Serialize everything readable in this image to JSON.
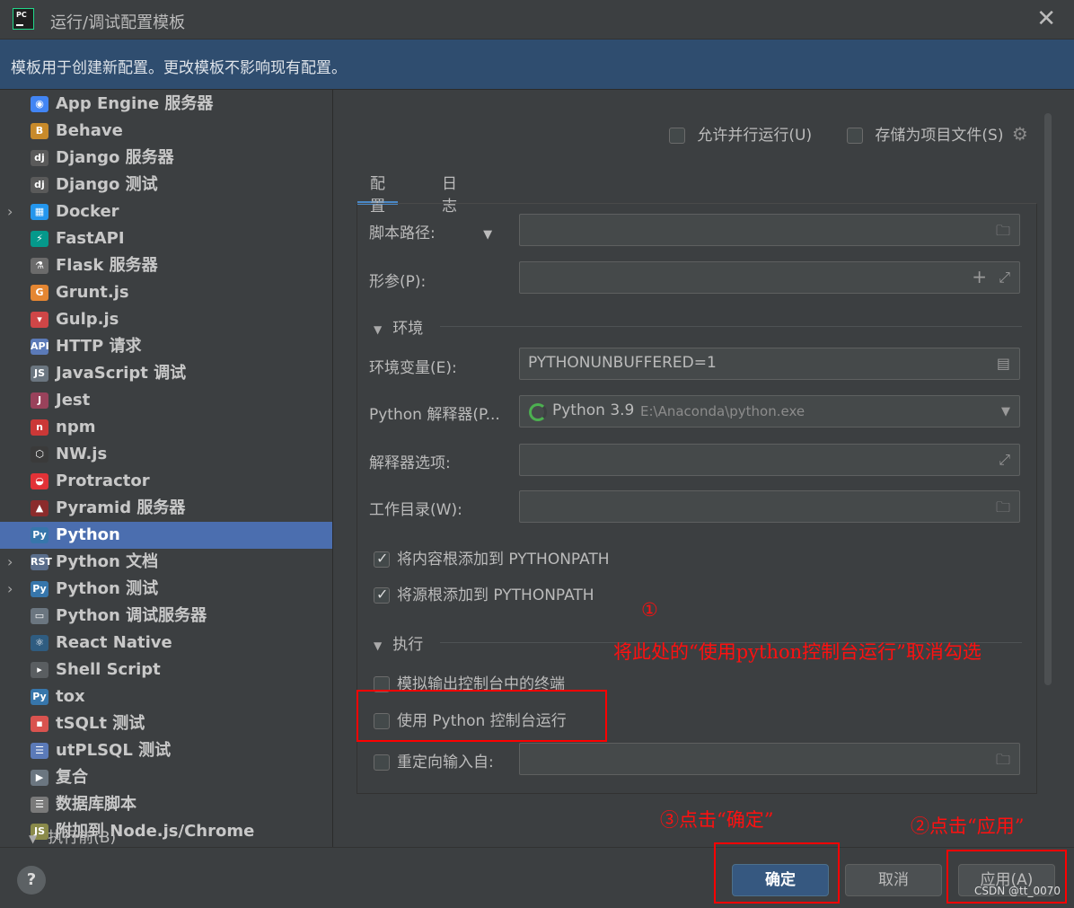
{
  "window": {
    "title": "运行/调试配置模板",
    "app_icon_text": "PC"
  },
  "banner": {
    "text": "模板用于创建新配置。更改模板不影响现有配置。"
  },
  "sidebar": {
    "items": [
      {
        "label": "App Engine 服务器",
        "icon": "app-engine-icon",
        "color": "#4285f4",
        "glyph": "◉",
        "expandable": false,
        "selected": false
      },
      {
        "label": "Behave",
        "icon": "behave-icon",
        "color": "#c88a2a",
        "glyph": "B",
        "expandable": false,
        "selected": false
      },
      {
        "label": "Django 服务器",
        "icon": "django-icon",
        "color": "#5a5a5a",
        "glyph": "dj",
        "expandable": false,
        "selected": false
      },
      {
        "label": "Django 测试",
        "icon": "django-test-icon",
        "color": "#5a5a5a",
        "glyph": "dj",
        "expandable": false,
        "selected": false
      },
      {
        "label": "Docker",
        "icon": "docker-icon",
        "color": "#2496ed",
        "glyph": "▦",
        "expandable": true,
        "selected": false
      },
      {
        "label": "FastAPI",
        "icon": "fastapi-icon",
        "color": "#05998b",
        "glyph": "⚡",
        "expandable": false,
        "selected": false
      },
      {
        "label": "Flask 服务器",
        "icon": "flask-icon",
        "color": "#6b6b6b",
        "glyph": "⚗",
        "expandable": false,
        "selected": false
      },
      {
        "label": "Grunt.js",
        "icon": "grunt-icon",
        "color": "#e48632",
        "glyph": "G",
        "expandable": false,
        "selected": false
      },
      {
        "label": "Gulp.js",
        "icon": "gulp-icon",
        "color": "#cf4647",
        "glyph": "▾",
        "expandable": false,
        "selected": false
      },
      {
        "label": "HTTP 请求",
        "icon": "http-api-icon",
        "color": "#5b7ab8",
        "glyph": "API",
        "expandable": false,
        "selected": false
      },
      {
        "label": "JavaScript 调试",
        "icon": "javascript-debug-icon",
        "color": "#6b7680",
        "glyph": "JS",
        "expandable": false,
        "selected": false
      },
      {
        "label": "Jest",
        "icon": "jest-icon",
        "color": "#99425b",
        "glyph": "J",
        "expandable": false,
        "selected": false
      },
      {
        "label": "npm",
        "icon": "npm-icon",
        "color": "#cb3837",
        "glyph": "n",
        "expandable": false,
        "selected": false
      },
      {
        "label": "NW.js",
        "icon": "nwjs-icon",
        "color": "#3a3a3a",
        "glyph": "⬡",
        "expandable": false,
        "selected": false
      },
      {
        "label": "Protractor",
        "icon": "protractor-icon",
        "color": "#e23237",
        "glyph": "◒",
        "expandable": false,
        "selected": false
      },
      {
        "label": "Pyramid 服务器",
        "icon": "pyramid-icon",
        "color": "#8b2c2c",
        "glyph": "▲",
        "expandable": false,
        "selected": false
      },
      {
        "label": "Python",
        "icon": "python-icon",
        "color": "#3776ab",
        "glyph": "Py",
        "expandable": false,
        "selected": true
      },
      {
        "label": "Python 文档",
        "icon": "python-docs-icon",
        "color": "#5a6e8c",
        "glyph": "RST",
        "expandable": true,
        "selected": false
      },
      {
        "label": "Python 测试",
        "icon": "python-tests-icon",
        "color": "#3776ab",
        "glyph": "Py",
        "expandable": true,
        "selected": false
      },
      {
        "label": "Python 调试服务器",
        "icon": "python-debug-server-icon",
        "color": "#6b7680",
        "glyph": "▭",
        "expandable": false,
        "selected": false
      },
      {
        "label": "React Native",
        "icon": "react-native-icon",
        "color": "#2f5c80",
        "glyph": "⚛",
        "expandable": false,
        "selected": false
      },
      {
        "label": "Shell Script",
        "icon": "shell-script-icon",
        "color": "#5a5e61",
        "glyph": "▸",
        "expandable": false,
        "selected": false
      },
      {
        "label": "tox",
        "icon": "tox-icon",
        "color": "#3776ab",
        "glyph": "Py",
        "expandable": false,
        "selected": false
      },
      {
        "label": "tSQLt 测试",
        "icon": "tsqlt-icon",
        "color": "#d9534f",
        "glyph": "▪",
        "expandable": false,
        "selected": false
      },
      {
        "label": "utPLSQL 测试",
        "icon": "utplsql-icon",
        "color": "#5b7ab8",
        "glyph": "☰",
        "expandable": false,
        "selected": false
      },
      {
        "label": "复合",
        "icon": "compound-icon",
        "color": "#6b7680",
        "glyph": "▶",
        "expandable": false,
        "selected": false
      },
      {
        "label": "数据库脚本",
        "icon": "database-script-icon",
        "color": "#7a7a7a",
        "glyph": "☰",
        "expandable": false,
        "selected": false
      },
      {
        "label": "附加到 Node.js/Chrome",
        "icon": "attach-node-icon",
        "color": "#8a8a4a",
        "glyph": "JS",
        "expandable": false,
        "selected": false
      }
    ]
  },
  "options": {
    "allow_parallel": {
      "label": "允许并行运行(U)",
      "checked": false
    },
    "store_as_project_file": {
      "label": "存储为项目文件(S)",
      "checked": false
    }
  },
  "tabs": [
    {
      "label": "配置",
      "active": true
    },
    {
      "label": "日志",
      "active": false
    }
  ],
  "form": {
    "script_path_label": "脚本路径:",
    "params_label": "形参(P):",
    "env_section": "环境",
    "env_vars_label": "环境变量(E):",
    "env_vars_value": "PYTHONUNBUFFERED=1",
    "interpreter_label": "Python 解释器(P...",
    "interpreter_name": "Python 3.9",
    "interpreter_path": "E:\\Anaconda\\python.exe",
    "interp_options_label": "解释器选项:",
    "workdir_label": "工作目录(W):",
    "add_content_roots": {
      "label": "将内容根添加到 PYTHONPATH",
      "checked": true
    },
    "add_source_roots": {
      "label": "将源根添加到 PYTHONPATH",
      "checked": true
    },
    "exec_section": "执行",
    "emulate_terminal": {
      "label": "模拟输出控制台中的终端",
      "checked": false
    },
    "run_with_console": {
      "label": "使用 Python 控制台运行",
      "checked": false
    },
    "redirect_input": {
      "label": "重定向输入自:",
      "checked": false
    },
    "before_launch": "执行前(B)"
  },
  "annotations": {
    "step1_number": "①",
    "step1_text": "将此处的“使用python控制台运行”取消勾选",
    "step2_text": "②点击“应用”",
    "step3_text": "③点击“确定”"
  },
  "footer": {
    "help": "?",
    "ok": "确定",
    "cancel": "取消",
    "apply": "应用(A)",
    "watermark": "CSDN @tt_0070"
  },
  "colors": {
    "selection": "#4b6eaf",
    "banner": "#2f4d6f",
    "annotation_red": "#ff0000",
    "primary_button": "#365880"
  }
}
